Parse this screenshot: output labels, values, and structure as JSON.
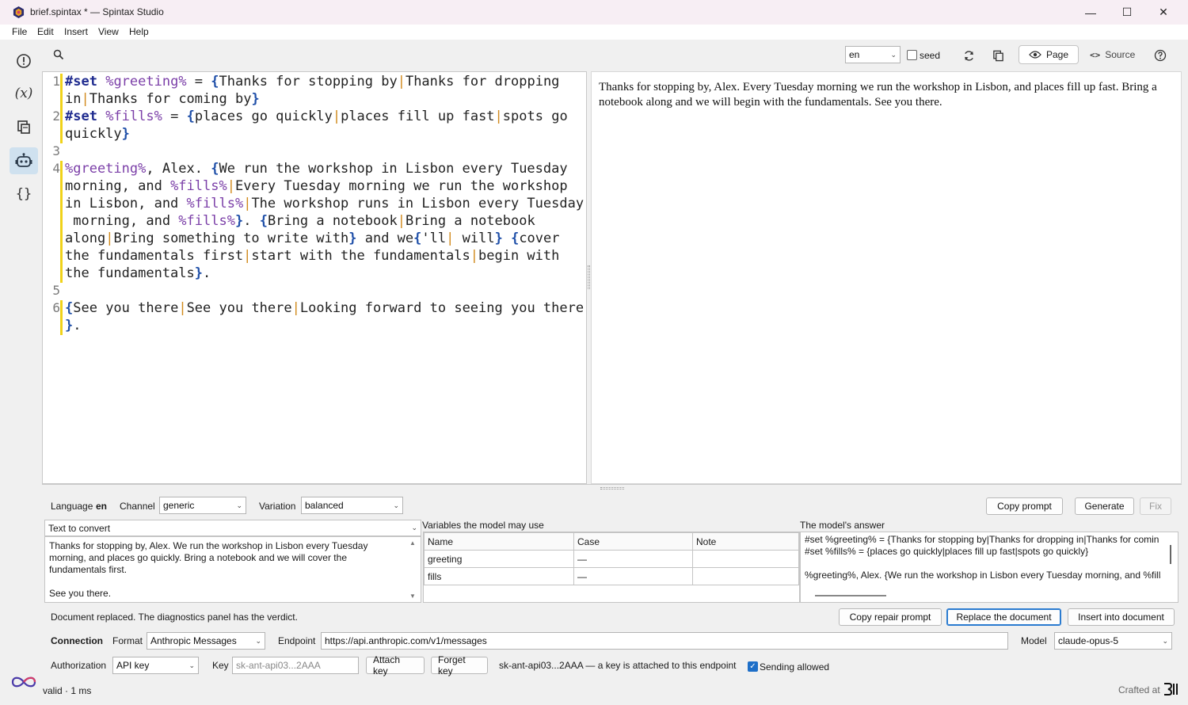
{
  "window": {
    "title": "brief.spintax * — Spintax Studio",
    "minimize_glyph": "—",
    "maximize_glyph": "☐",
    "close_glyph": "✕"
  },
  "menu": [
    "File",
    "Edit",
    "Insert",
    "View",
    "Help"
  ],
  "rail": {
    "icons": [
      "alert-icon",
      "variable-icon",
      "copy-icon",
      "robot-icon",
      "braces-icon"
    ],
    "variable_glyph": "(x)",
    "braces_glyph": "{}"
  },
  "toolbar": {
    "language": "en",
    "seed_label": "seed",
    "page_label": "Page",
    "source_label": "Source"
  },
  "editor": {
    "line_numbers": [
      "1",
      "2",
      "3",
      "4",
      "5",
      "6"
    ]
  },
  "preview": {
    "text": "Thanks for stopping by, Alex. Every Tuesday morning we run the workshop in Lisbon, and places fill up fast. Bring a notebook along and we will begin with the fundamentals. See you there."
  },
  "prompt_panel": {
    "language_label": "Language",
    "language_value": "en",
    "channel_label": "Channel",
    "channel_value": "generic",
    "variation_label": "Variation",
    "variation_value": "balanced",
    "copy_prompt": "Copy prompt",
    "generate": "Generate",
    "fix": "Fix",
    "text_to_convert_label": "Text to convert",
    "text_to_convert_p1": "Thanks for stopping by, Alex. We run the workshop in Lisbon every Tuesday morning, and places go quickly. Bring a notebook and we will cover the fundamentals first.",
    "text_to_convert_p2": "See you there.",
    "variables_label": "Variables the model may use",
    "var_headers": [
      "Name",
      "Case",
      "Note"
    ],
    "var_rows": [
      [
        "greeting",
        "—",
        ""
      ],
      [
        "fills",
        "—",
        ""
      ]
    ],
    "answer_label": "The model's answer",
    "answer_lines": [
      "#set %greeting% = {Thanks for stopping by|Thanks for dropping in|Thanks for comin",
      "#set %fills% = {places go quickly|places fill up fast|spots go quickly}",
      "",
      "%greeting%, Alex. {We run the workshop in Lisbon every Tuesday morning, and %fills"
    ],
    "status_message": "Document replaced. The diagnostics panel has the verdict.",
    "copy_repair_prompt": "Copy repair prompt",
    "replace_document": "Replace the document",
    "insert_into_document": "Insert into document"
  },
  "connection": {
    "heading": "Connection",
    "format_label": "Format",
    "format_value": "Anthropic Messages",
    "endpoint_label": "Endpoint",
    "endpoint_value": "https://api.anthropic.com/v1/messages",
    "model_label": "Model",
    "model_value": "claude-opus-5",
    "authorization_label": "Authorization",
    "authorization_value": "API key",
    "key_label": "Key",
    "key_placeholder": "sk-ant-api03...2AAA",
    "attach_key": "Attach key",
    "forget_key": "Forget key",
    "key_status": "sk-ant-api03...2AAA — a key is attached to this endpoint",
    "sending_allowed": "Sending allowed"
  },
  "status": {
    "left": "valid · 1 ms",
    "crafted": "Crafted at"
  }
}
